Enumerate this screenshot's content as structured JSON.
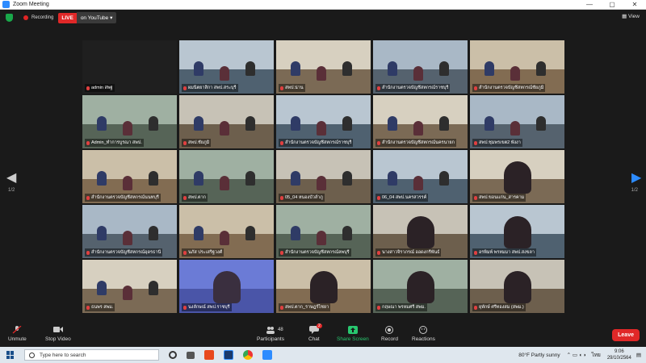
{
  "window": {
    "title": "Zoom Meeting",
    "controls": [
      "—",
      "▢",
      "✕"
    ]
  },
  "topbar": {
    "recording_label": "Recording",
    "live_label": "LIVE",
    "stream_target": "on YouTube ▾",
    "view_label": "View"
  },
  "colors": {
    "accent": "#2d8cff",
    "live_red": "#e02828",
    "share_green": "#28c76f",
    "active_speaker": "#d6e36a"
  },
  "gallery": {
    "page_left": "1/2",
    "page_right": "1/2",
    "tiles": [
      {
        "label": "admin สพฐ",
        "type": "dark"
      },
      {
        "label": "ผมนิตยาสิกา สพป.สระบุรี",
        "type": "room"
      },
      {
        "label": "สพป.น่าน",
        "type": "room"
      },
      {
        "label": "สำนักงานตรวจบัญชีสหกรณ์ราชบุรี",
        "type": "room"
      },
      {
        "label": "สำนักงานตรวจบัญชีสหกรณ์ชัยภูมิ",
        "type": "room"
      },
      {
        "label": "Admin_ทำการบูรณา สพป.",
        "type": "room"
      },
      {
        "label": "สพป.ชัยภูมิ",
        "type": "room"
      },
      {
        "label": "สำนักงานตรวจบัญชีสหกรณ์ราชบุรี",
        "type": "room"
      },
      {
        "label": "สำนักงานตรวจบัญชีสหกรณ์นครนายก",
        "type": "room"
      },
      {
        "label": "สพป.ชุมพรเขต2 พังงา",
        "type": "room"
      },
      {
        "label": "สำนักงานตรวจบัญชีสหกรณ์นนทบุรี",
        "type": "room"
      },
      {
        "label": "สพป.ตาก",
        "type": "room"
      },
      {
        "label": "05_04 หนองบัวลำภู",
        "type": "room"
      },
      {
        "label": "06_04 สพป.นครสวรรค์",
        "type": "room"
      },
      {
        "label": "สพป.ขอนแก่น_สารคาม",
        "type": "person"
      },
      {
        "label": "สำนักงานตรวจบัญชีสหกรณ์อุดรธานี",
        "type": "room"
      },
      {
        "label": "นภัส ประเสริฐวงศ์",
        "type": "room"
      },
      {
        "label": "สำนักงานตรวจบัญชีสหกรณ์ลพบุรี",
        "type": "room"
      },
      {
        "label": "นางสาวจิราภรณ์ ออดงกรีพันธ์",
        "type": "person"
      },
      {
        "label": "อรพิมพ์ พรหมมา สพป.สงขลา",
        "type": "person"
      },
      {
        "label": "ธนพร สพม.",
        "type": "room"
      },
      {
        "label": "นงลักษณ์ สพป.ราชบุรี",
        "type": "speaker"
      },
      {
        "label": "สพป.ตาก_ราษฎร์ไชยา",
        "type": "person"
      },
      {
        "label": "กฤษณา พรหมศรี สพม.",
        "type": "person"
      },
      {
        "label": "ยุพักษ์ ศรีทองสม (สพม.)",
        "type": "person"
      }
    ]
  },
  "toolbar": {
    "unmute": "Unmute",
    "stop_video": "Stop Video",
    "participants": "Participants",
    "participants_count": "48",
    "chat": "Chat",
    "chat_badge": "2",
    "share_screen": "Share Screen",
    "record": "Record",
    "reactions": "Reactions",
    "leave": "Leave"
  },
  "taskbar": {
    "search_placeholder": "Type here to search",
    "weather": "80°F  Partly sunny",
    "language": "ไทย",
    "time": "9:06",
    "date": "29/10/2564"
  }
}
